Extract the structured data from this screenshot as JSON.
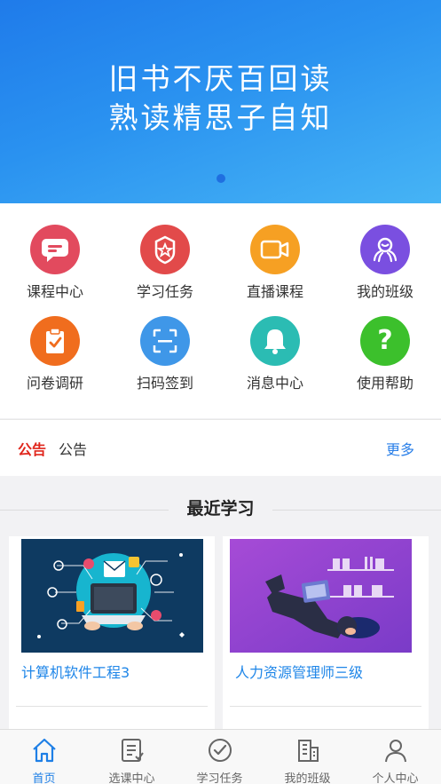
{
  "banner": {
    "line1": "旧书不厌百回读",
    "line2": "熟读精思子自知",
    "gradient_start": "#1f7bea",
    "gradient_end": "#46b4f5"
  },
  "grid": [
    {
      "label": "课程中心",
      "icon": "chat-card-icon",
      "color": "#e24a5e"
    },
    {
      "label": "学习任务",
      "icon": "star-badge-icon",
      "color": "#e24a4a"
    },
    {
      "label": "直播课程",
      "icon": "video-camera-icon",
      "color": "#f6a023"
    },
    {
      "label": "我的班级",
      "icon": "team-icon",
      "color": "#7a4fe0"
    },
    {
      "label": "问卷调研",
      "icon": "clipboard-check-icon",
      "color": "#f06d1e"
    },
    {
      "label": "扫码签到",
      "icon": "scan-icon",
      "color": "#3f97e8"
    },
    {
      "label": "消息中心",
      "icon": "bell-icon",
      "color": "#2bbcb3"
    },
    {
      "label": "使用帮助",
      "icon": "question-icon",
      "color": "#3cc02c"
    }
  ],
  "notice": {
    "tag": "公告",
    "text": "公告",
    "more": "更多"
  },
  "recent": {
    "title": "最近学习",
    "courses": [
      {
        "title": "计算机软件工程3",
        "image": "laptop-network-illustration"
      },
      {
        "title": "人力资源管理师三级",
        "image": "reading-person-illustration"
      }
    ]
  },
  "tabbar": [
    {
      "label": "首页",
      "icon": "home-icon",
      "active": true
    },
    {
      "label": "选课中心",
      "icon": "list-icon",
      "active": false
    },
    {
      "label": "学习任务",
      "icon": "check-circle-icon",
      "active": false
    },
    {
      "label": "我的班级",
      "icon": "building-icon",
      "active": false
    },
    {
      "label": "个人中心",
      "icon": "person-icon",
      "active": false
    }
  ],
  "colors": {
    "accent": "#1e7fe6",
    "notice_tag": "#e0261c"
  }
}
